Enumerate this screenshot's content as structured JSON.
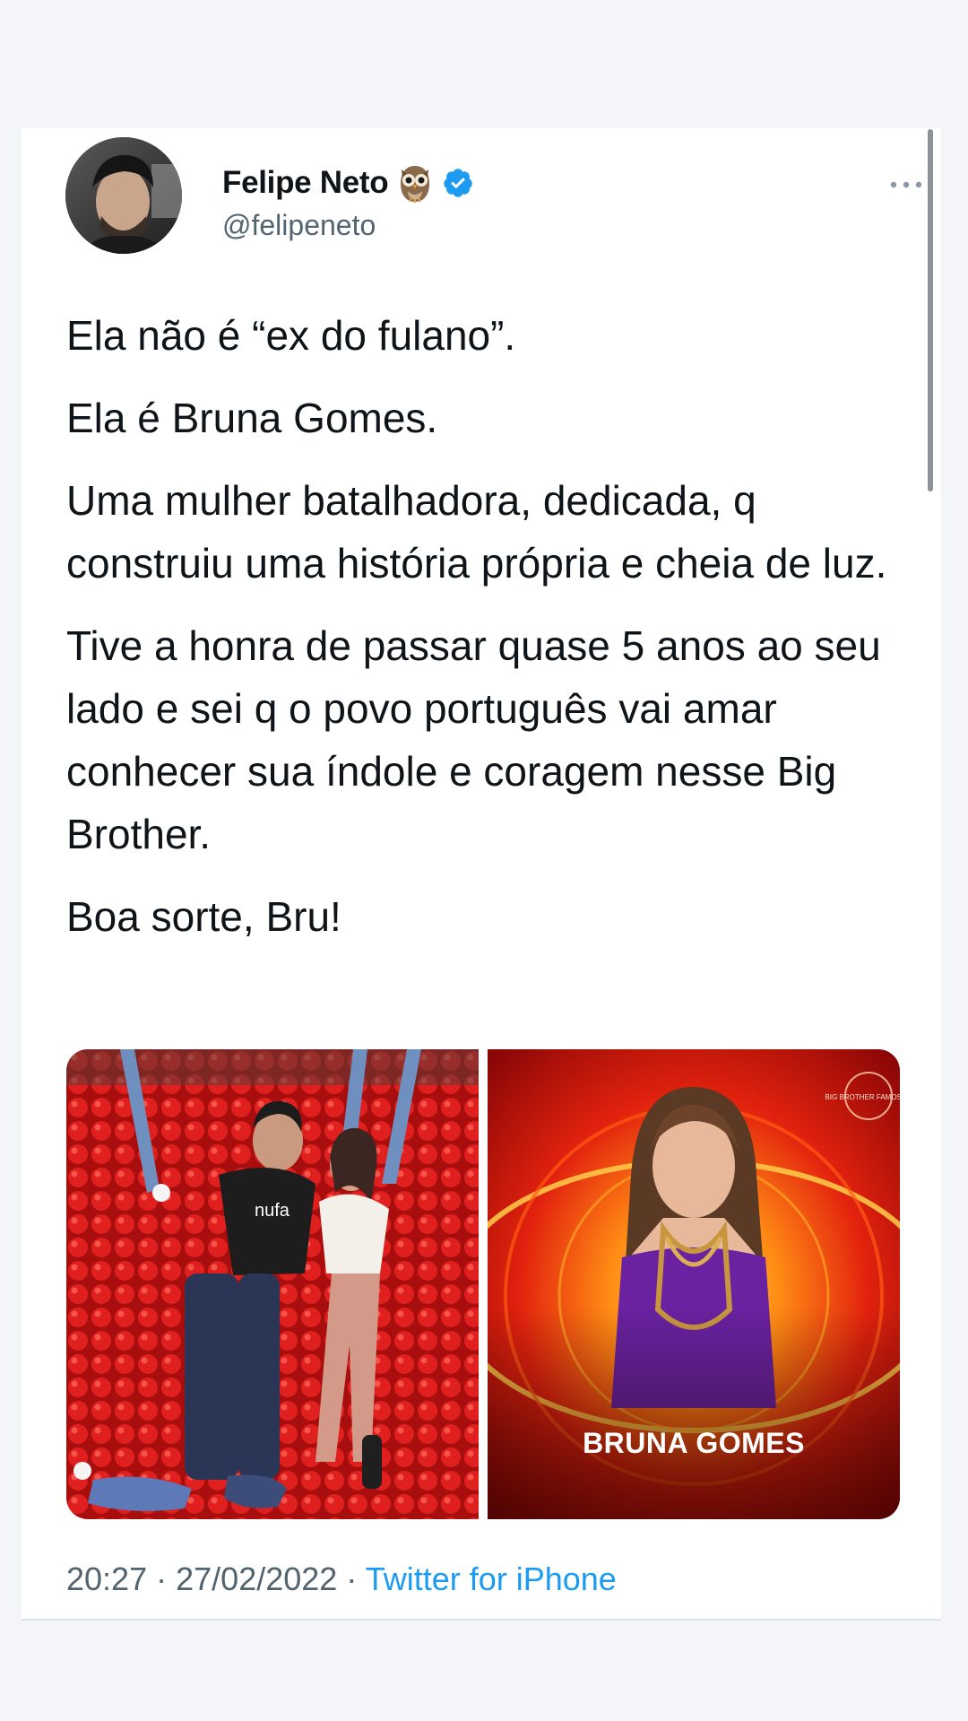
{
  "tweet": {
    "author": {
      "display_name": "Felipe Neto",
      "handle": "@felipeneto",
      "avatar": "avatar-photo",
      "emoji_icon": "owl-icon",
      "verified": true
    },
    "menu_icon": "more-icon",
    "paragraphs": [
      "Ela não é “ex do fulano”.",
      "Ela é Bruna Gomes.",
      "Uma mulher batalhadora, dedicada, q construiu uma história própria e cheia de luz.",
      "Tive a honra de passar quase 5 anos ao seu lado e sei q o povo português vai amar conhecer sua índole e coragem nesse Big Brother.",
      "Boa sorte, Bru!"
    ],
    "media": {
      "image_1": "photo-couple-in-ball-pit",
      "image_2": "photo-bruna-gomes-promo",
      "image_2_caption": "BRUNA GOMES",
      "image_2_logo": "BIG BROTHER FAMOSOS",
      "image_1_shirt_text": "nufa"
    },
    "time": "20:27",
    "separator": "·",
    "date": "27/02/2022",
    "source": "Twitter for iPhone"
  },
  "colors": {
    "text": "#0f1419",
    "secondary": "#536471",
    "link": "#1d9bf0",
    "verified": "#1d9bf0"
  }
}
